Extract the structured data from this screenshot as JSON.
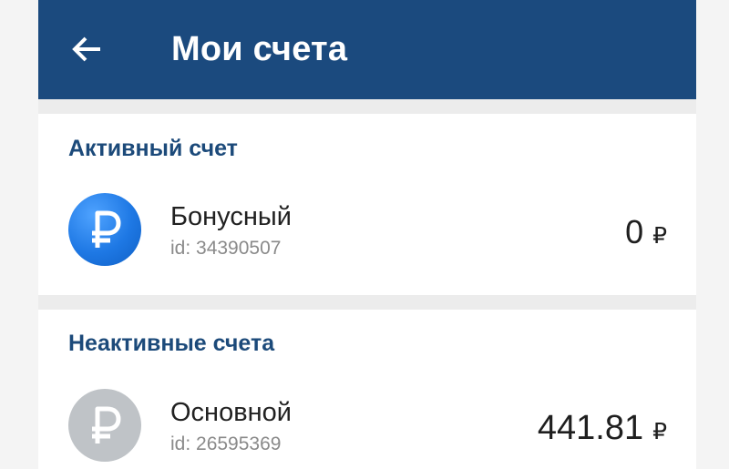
{
  "header": {
    "title": "Мои счета",
    "back_icon": "arrow-left-icon"
  },
  "colors": {
    "appbar": "#1b4a7e",
    "section_title": "#1c4a7a",
    "active_avatar": "#1e78e4",
    "inactive_avatar": "#bfc3c7"
  },
  "active_section": {
    "title": "Активный счет",
    "account": {
      "name": "Бонусный",
      "id": "id: 34390507",
      "balance": "0",
      "currency": "₽",
      "icon": "ruble-icon"
    }
  },
  "inactive_section": {
    "title": "Неактивные счета",
    "account": {
      "name": "Основной",
      "id": "id: 26595369",
      "balance": "441.81",
      "currency": "₽",
      "icon": "ruble-icon"
    }
  }
}
